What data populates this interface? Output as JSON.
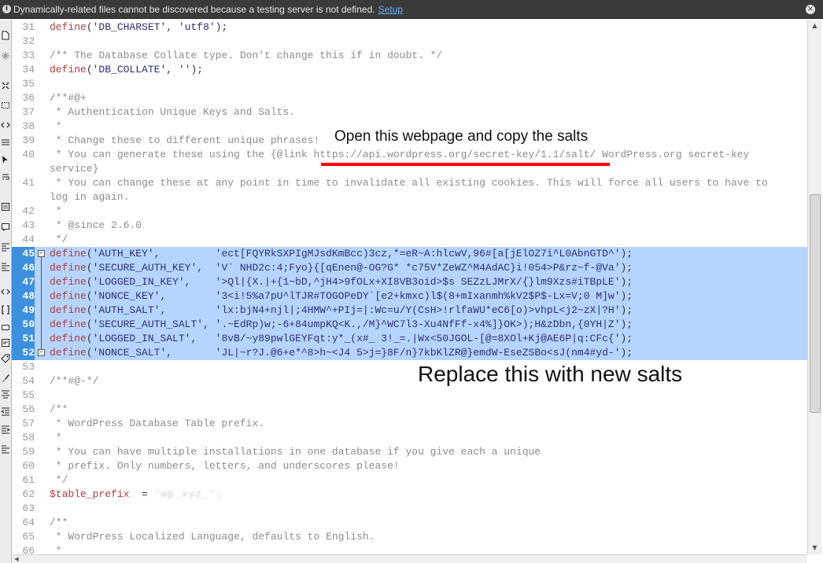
{
  "infobar": {
    "message": "Dynamically-related files cannot be discovered because a testing server is not defined.",
    "link": "Setup",
    "info_icon": "info-icon",
    "close_icon": "close-icon"
  },
  "toolbar": {
    "icons": [
      "document-icon",
      "asterisk-icon",
      "expand-icon",
      "select-icon",
      "code-icon",
      "line-icon",
      "cursor-icon",
      "wrap-icon",
      "list-icon",
      "comment-icon",
      "block-icon",
      "format-icon",
      "code-icon",
      "brackets-icon",
      "chat-icon",
      "snippet-icon",
      "tag-icon",
      "brush-icon",
      "align-icon",
      "indent-left-icon",
      "indent-right-icon",
      "format-icon"
    ]
  },
  "editor": {
    "lines": [
      {
        "num": "31",
        "parts": [
          [
            "kw",
            "define"
          ],
          [
            "pl",
            "("
          ],
          [
            "st",
            "'DB_CHARSET'"
          ],
          [
            "pl",
            ", "
          ],
          [
            "st",
            "'utf8'"
          ],
          [
            "pl",
            ");"
          ]
        ]
      },
      {
        "num": "32",
        "parts": []
      },
      {
        "num": "33",
        "parts": [
          [
            "cm",
            "/** The Database Collate type. Don't change this if in doubt. */"
          ]
        ]
      },
      {
        "num": "34",
        "parts": [
          [
            "kw",
            "define"
          ],
          [
            "pl",
            "("
          ],
          [
            "st",
            "'DB_COLLATE'"
          ],
          [
            "pl",
            ", "
          ],
          [
            "st",
            "''"
          ],
          [
            "pl",
            ");"
          ]
        ]
      },
      {
        "num": "35",
        "parts": []
      },
      {
        "num": "36",
        "parts": [
          [
            "cm",
            "/**#@+"
          ]
        ]
      },
      {
        "num": "37",
        "parts": [
          [
            "cm",
            " * Authentication Unique Keys and Salts."
          ]
        ]
      },
      {
        "num": "38",
        "parts": [
          [
            "cm",
            " *"
          ]
        ]
      },
      {
        "num": "39",
        "parts": [
          [
            "cm",
            " * Change these to different unique phrases!"
          ]
        ]
      },
      {
        "num": "40",
        "parts": [
          [
            "cm",
            " * You can generate these using the {@link https://api.wordpress.org/secret-key/1.1/salt/ WordPress.org secret-key"
          ]
        ]
      },
      {
        "num": "",
        "parts": [
          [
            "cm",
            "service}"
          ]
        ]
      },
      {
        "num": "41",
        "parts": [
          [
            "cm",
            " * You can change these at any point in time to invalidate all existing cookies. This will force all users to have to"
          ]
        ]
      },
      {
        "num": "",
        "parts": [
          [
            "cm",
            "log in again."
          ]
        ]
      },
      {
        "num": "42",
        "parts": [
          [
            "cm",
            " *"
          ]
        ]
      },
      {
        "num": "43",
        "parts": [
          [
            "cm",
            " * @since 2.6.0"
          ]
        ]
      },
      {
        "num": "44",
        "parts": [
          [
            "cm",
            " */"
          ]
        ]
      },
      {
        "num": "45",
        "sel": true,
        "parts": [
          [
            "kw",
            "define"
          ],
          [
            "pl",
            "("
          ],
          [
            "st",
            "'AUTH_KEY',         'ect[FQYRkSXPIgMJsdKmBcc)3cz,*=eR~A:hlcwV,96#[a[jElOZ7i^L0AbnGTD^'"
          ],
          [
            "pl",
            ");"
          ]
        ]
      },
      {
        "num": "46",
        "sel": true,
        "parts": [
          [
            "kw",
            "define"
          ],
          [
            "pl",
            "("
          ],
          [
            "st",
            "'SECURE_AUTH_KEY',  'V` NHD2c:4;Fyo}{[qEnen@-OG?G* *c75V*ZeWZ^M4AdAC}i!054>P&rz~f-@Va'"
          ],
          [
            "pl",
            ");"
          ]
        ]
      },
      {
        "num": "47",
        "sel": true,
        "parts": [
          [
            "kw",
            "define"
          ],
          [
            "pl",
            "("
          ],
          [
            "st",
            "'LOGGED_IN_KEY',    '>Ql|{X.|+{1~bD,^jH4>9fOLx+XI8VB3oid>$s SEZzLJMrX/{}lm9Xzs#iTBpLE'"
          ],
          [
            "pl",
            ");"
          ]
        ]
      },
      {
        "num": "48",
        "sel": true,
        "parts": [
          [
            "kw",
            "define"
          ],
          [
            "pl",
            "("
          ],
          [
            "st",
            "'NONCE_KEY',        '3<i!5%a7pU^lTJR#TOGOPeDY`[e2+kmxc)l$(8+mIxanmh%kV2$P$-Lx=V;0 M]w'"
          ],
          [
            "pl",
            ");"
          ]
        ]
      },
      {
        "num": "49",
        "sel": true,
        "parts": [
          [
            "kw",
            "define"
          ],
          [
            "pl",
            "("
          ],
          [
            "st",
            "'AUTH_SALT',        'lx:bjN4+njl|;4HMW^+PIj=|:Wc=u/Y(CsH>!rlfaWU*eC6[o)>vhpL<j2~zX|?H'"
          ],
          [
            "pl",
            ");"
          ]
        ]
      },
      {
        "num": "50",
        "sel": true,
        "parts": [
          [
            "kw",
            "define"
          ],
          [
            "pl",
            "("
          ],
          [
            "st",
            "'SECURE_AUTH_SALT', '.~EdRp)w;-6+84umpKQ<K.,/M}^WC7l3-Xu4NfFf-x4%]}OK>);H&zDbn,{0YH|Z'"
          ],
          [
            "pl",
            ");"
          ]
        ]
      },
      {
        "num": "51",
        "sel": true,
        "parts": [
          [
            "kw",
            "define"
          ],
          [
            "pl",
            "("
          ],
          [
            "st",
            "'LOGGED_IN_SALT',   '8vB/~y89pwlGEYFqt:y*_(x#_ 3!_=.|Wx<50JGOL-[@=8XOl+Kj@AE6P|q:CFc{'"
          ],
          [
            "pl",
            ");"
          ]
        ]
      },
      {
        "num": "52",
        "sel": true,
        "parts": [
          [
            "kw",
            "define"
          ],
          [
            "pl",
            "("
          ],
          [
            "st",
            "'NONCE_SALT',       'JL|~r?J.@6+e*^8>h~<J4 5>j=}8F/n}7kbKlZR@}emdW-EseZSBo<sJ(nm4#yd-'"
          ],
          [
            "pl",
            ");"
          ]
        ]
      },
      {
        "num": "53",
        "parts": []
      },
      {
        "num": "54",
        "parts": [
          [
            "cm",
            "/**#@-*/"
          ]
        ]
      },
      {
        "num": "55",
        "parts": []
      },
      {
        "num": "56",
        "parts": [
          [
            "cm",
            "/**"
          ]
        ]
      },
      {
        "num": "57",
        "parts": [
          [
            "cm",
            " * WordPress Database Table prefix."
          ]
        ]
      },
      {
        "num": "58",
        "parts": [
          [
            "cm",
            " *"
          ]
        ]
      },
      {
        "num": "59",
        "parts": [
          [
            "cm",
            " * You can have multiple installations in one database if you give each a unique"
          ]
        ]
      },
      {
        "num": "60",
        "parts": [
          [
            "cm",
            " * prefix. Only numbers, letters, and underscores please!"
          ]
        ]
      },
      {
        "num": "61",
        "parts": [
          [
            "cm",
            " */"
          ]
        ]
      },
      {
        "num": "62",
        "parts": [
          [
            "var",
            "$table_prefix"
          ],
          [
            "pl",
            "  = "
          ],
          [
            "blur",
            "'wp_xyz_';"
          ]
        ]
      },
      {
        "num": "63",
        "parts": []
      },
      {
        "num": "64",
        "parts": [
          [
            "cm",
            "/**"
          ]
        ]
      },
      {
        "num": "65",
        "parts": [
          [
            "cm",
            " * WordPress Localized Language, defaults to English."
          ]
        ]
      },
      {
        "num": "66",
        "parts": [
          [
            "cm",
            " *"
          ]
        ]
      }
    ]
  },
  "annotations": {
    "top": "Open this webpage and copy the salts",
    "bottom": "Replace this with new salts"
  }
}
